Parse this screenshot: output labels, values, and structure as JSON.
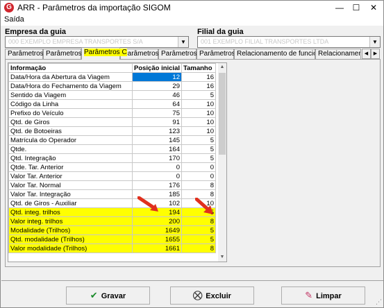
{
  "window": {
    "app_icon_letter": "G",
    "title": "ARR - Parâmetros da importação  SIGOM",
    "minimize": "—",
    "maximize": "☐",
    "close": "✕"
  },
  "menu": {
    "items": [
      "Saída"
    ]
  },
  "empresa": {
    "label": "Empresa  da guia",
    "value": "000 EXEMPLO EMPRESA TRANSPORTES S/A"
  },
  "filial": {
    "label": "Filial  da guia",
    "value": "001 EXEMPLO FILIAL TRANSPORTES LTDA"
  },
  "tabs": [
    "Parâmetros A",
    "Parâmetros B",
    "Parâmetros C",
    "Parâmetros D",
    "Parâmetros E",
    "Parâmetros F",
    "Relacionamento de funcionários",
    "Relacionamento de v"
  ],
  "active_tab": "Parâmetros C",
  "table": {
    "headers": [
      "Informação",
      "Posição inicial",
      "Tamanho"
    ],
    "rows": [
      [
        "Data/Hora da Abertura da Viagem",
        "12",
        "16"
      ],
      [
        "Data/Hora do Fechamento da Viagem",
        "29",
        "16"
      ],
      [
        "Sentido da Viagem",
        "46",
        "5"
      ],
      [
        "Código da Linha",
        "64",
        "10"
      ],
      [
        "Prefixo do Veículo",
        "75",
        "10"
      ],
      [
        "Qtd. de Giros",
        "91",
        "10"
      ],
      [
        "Qtd. de Botoeiras",
        "123",
        "10"
      ],
      [
        "Matrícula do Operador",
        "145",
        "5"
      ],
      [
        "Qtde.",
        "164",
        "5"
      ],
      [
        "Qtd. Integração",
        "170",
        "5"
      ],
      [
        "Qtde. Tar. Anterior",
        "0",
        "0"
      ],
      [
        "Valor Tar. Anterior",
        "0",
        "0"
      ],
      [
        "Valor Tar. Normal",
        "176",
        "8"
      ],
      [
        "Valor Tar. Integração",
        "185",
        "8"
      ],
      [
        "Qtd. de Giros - Auxiliar",
        "102",
        "10"
      ],
      [
        "Qtd. integ. trilhos",
        "194",
        "5"
      ],
      [
        "Valor integ. trilhos",
        "200",
        "8"
      ],
      [
        "Modalidade (Trilhos)",
        "1649",
        "5"
      ],
      [
        "Qtd. modalidade (Trilhos)",
        "1655",
        "5"
      ],
      [
        "Valor modalidade (Trilhos)",
        "1661",
        "8"
      ]
    ],
    "highlight_color": "#ffff00",
    "selection_color": "#0078d7"
  },
  "buttons": {
    "gravar": {
      "label": "Gravar",
      "icon": "✔"
    },
    "excluir": {
      "label": "Excluir",
      "icon": "⛒"
    },
    "limpar": {
      "label": "Limpar",
      "icon": "✎"
    }
  }
}
